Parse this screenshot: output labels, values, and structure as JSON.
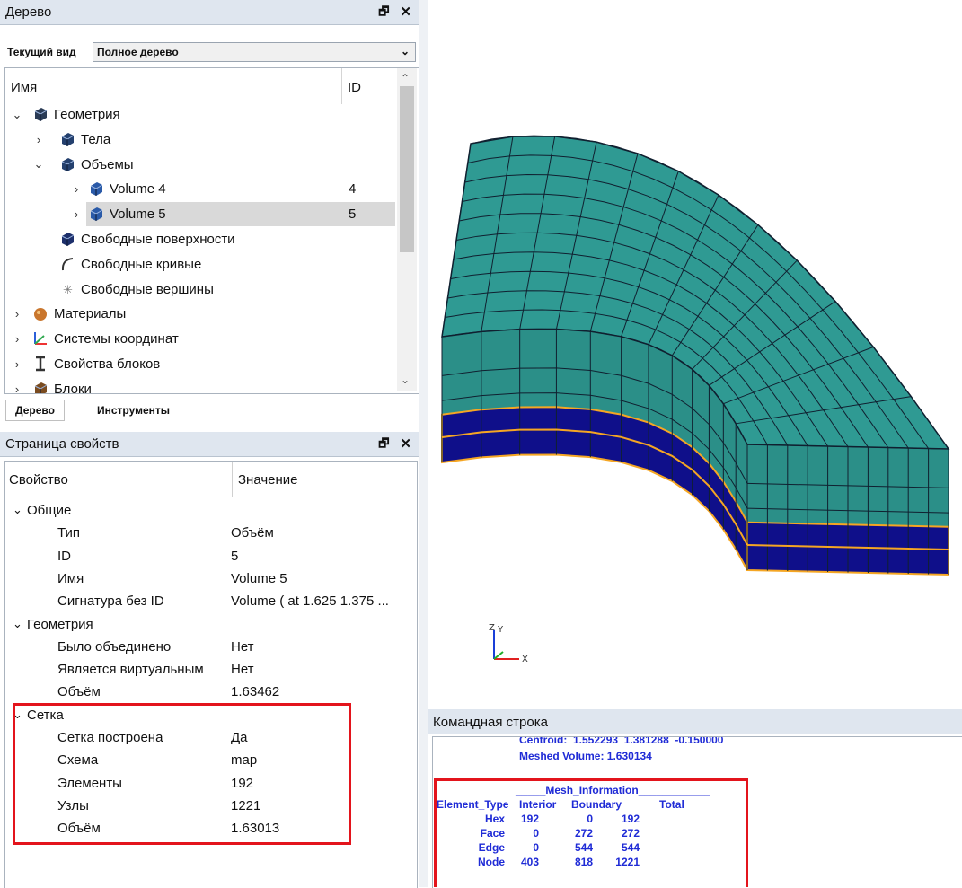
{
  "tree_panel": {
    "title": "Дерево",
    "float_btn": "🗗",
    "close_btn": "✕",
    "current_view_label": "Текущий вид",
    "current_view_value": "Полное дерево",
    "col_name": "Имя",
    "col_id": "ID",
    "items": [
      {
        "label": "Геометрия",
        "id": "",
        "expander": "⌄",
        "icon": "geometry-icon"
      },
      {
        "label": "Тела",
        "id": "",
        "expander": "›",
        "icon": "bodies-icon"
      },
      {
        "label": "Объемы",
        "id": "",
        "expander": "⌄",
        "icon": "volumes-icon"
      },
      {
        "label": "Volume 4",
        "id": "4",
        "expander": "›",
        "icon": "volume-icon"
      },
      {
        "label": "Volume 5",
        "id": "5",
        "expander": "›",
        "icon": "volume-icon",
        "selected": true
      },
      {
        "label": "Свободные поверхности",
        "id": "",
        "expander": "",
        "icon": "surface-icon"
      },
      {
        "label": "Свободные кривые",
        "id": "",
        "expander": "",
        "icon": "curve-icon"
      },
      {
        "label": "Свободные вершины",
        "id": "",
        "expander": "",
        "icon": "vertex-icon"
      },
      {
        "label": "Материалы",
        "id": "",
        "expander": "›",
        "icon": "materials-icon"
      },
      {
        "label": "Системы координат",
        "id": "",
        "expander": "›",
        "icon": "coord-system-icon"
      },
      {
        "label": "Свойства блоков",
        "id": "",
        "expander": "›",
        "icon": "block-properties-icon"
      },
      {
        "label": "Блоки",
        "id": "",
        "expander": "›",
        "icon": "blocks-icon"
      }
    ],
    "tabs": [
      "Дерево",
      "Инструменты"
    ]
  },
  "properties_panel": {
    "title": "Страница свойств",
    "col_property": "Свойство",
    "col_value": "Значение",
    "rows": [
      {
        "key": "Общие",
        "value": "",
        "group": true
      },
      {
        "key": "Тип",
        "value": "Объём"
      },
      {
        "key": "ID",
        "value": "5"
      },
      {
        "key": "Имя",
        "value": "Volume 5"
      },
      {
        "key": "Сигнатура без ID",
        "value": "Volume ( at 1.625 1.375 ..."
      },
      {
        "key": "Геометрия",
        "value": "",
        "group": true
      },
      {
        "key": "Было объединено",
        "value": "Нет"
      },
      {
        "key": "Является виртуальным",
        "value": "Нет"
      },
      {
        "key": "Объём",
        "value": "1.63462"
      },
      {
        "key": "Сетка",
        "value": "",
        "group": true
      },
      {
        "key": "Сетка построена",
        "value": "Да"
      },
      {
        "key": "Схема",
        "value": "map"
      },
      {
        "key": "Элементы",
        "value": "192"
      },
      {
        "key": "Узлы",
        "value": "1221"
      },
      {
        "key": "Объём",
        "value": "1.63013"
      }
    ]
  },
  "viewport": {
    "axis_z": "Z",
    "axis_y": "Y",
    "axis_x": "X",
    "colors": {
      "top": "#2f9a93",
      "side": "#2b8f88",
      "bottom": "#0f0f8a",
      "edge": "#f5a623"
    }
  },
  "command_panel": {
    "title": "Командная строка",
    "line1": "Centroid:  1.552293  1.381288  -0.150000",
    "line2": "Meshed Volume: 1.630134",
    "mesh_title": "_____Mesh_Information____________",
    "headers": [
      "Element_Type",
      "Interior",
      "Boundary",
      "Total"
    ],
    "rows": [
      [
        "Hex",
        "192",
        "0",
        "192"
      ],
      [
        "Face",
        "0",
        "272",
        "272"
      ],
      [
        "Edge",
        "0",
        "544",
        "544"
      ],
      [
        "Node",
        "403",
        "818",
        "1221"
      ]
    ]
  }
}
